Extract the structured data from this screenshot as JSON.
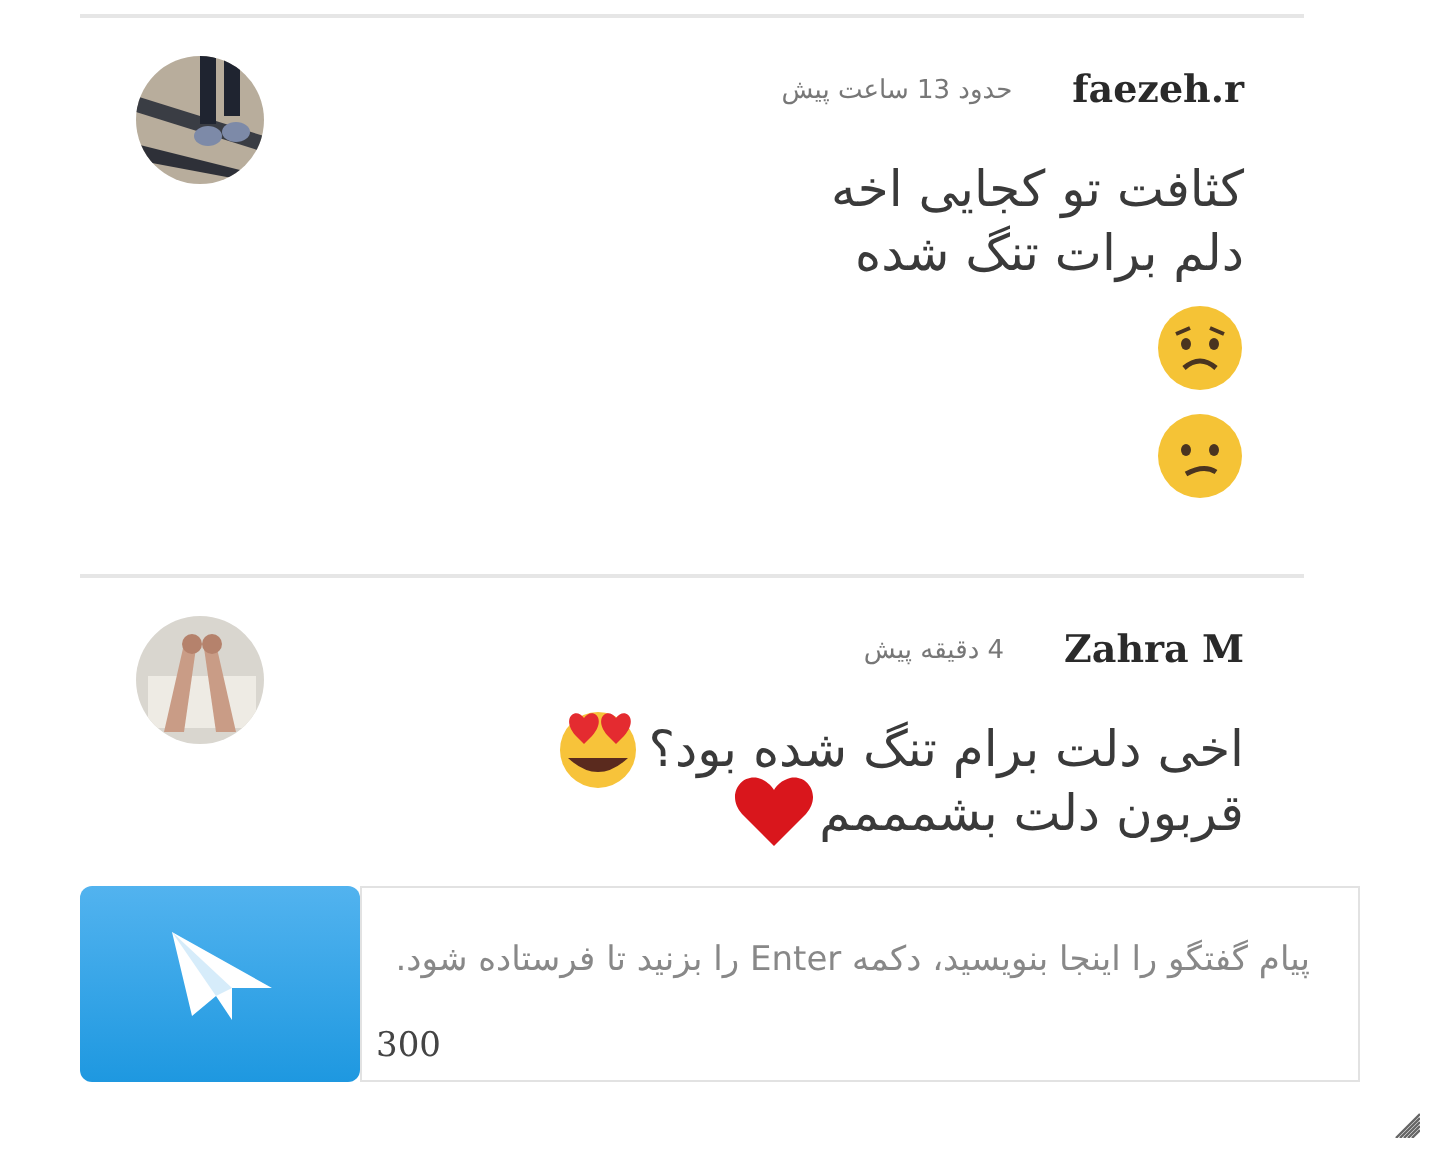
{
  "messages": [
    {
      "author": "faezeh.r",
      "time": "حدود 13 ساعت پیش",
      "lines": [
        "کثافت تو کجایی اخه",
        "دلم برات تنگ شده"
      ]
    },
    {
      "author": "Zahra M",
      "time": "4 دقیقه پیش",
      "lines": [
        "اخی دلت برام تنگ شده بود؟",
        "قربون دلت بشمممم"
      ]
    }
  ],
  "composer": {
    "placeholder": "پیام گفتگو را اینجا بنویسید، دکمه Enter را بزنید تا فرستاده شود.",
    "counter": "300"
  }
}
